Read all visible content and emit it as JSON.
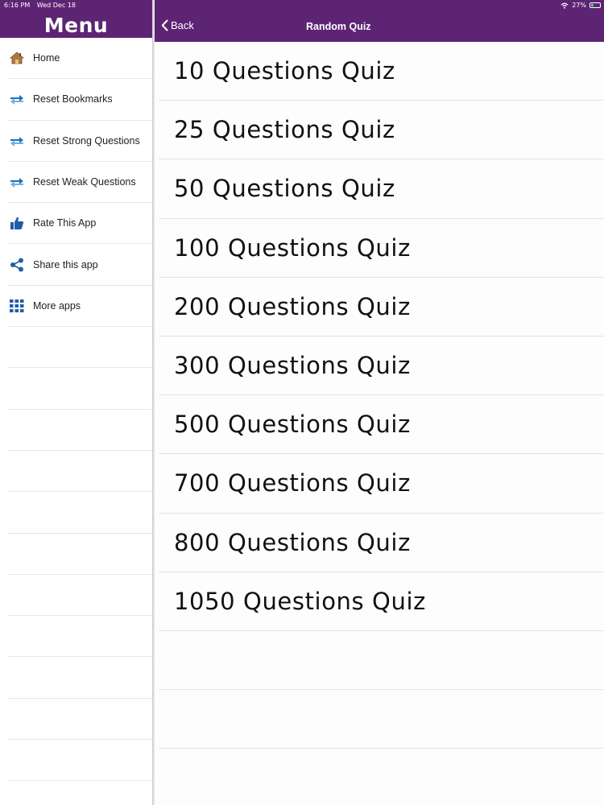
{
  "status_bar": {
    "time": "6:16 PM",
    "date": "Wed Dec 18",
    "battery": "27%"
  },
  "sidebar": {
    "title": "Menu",
    "items": [
      {
        "label": "Home",
        "icon": "house-icon"
      },
      {
        "label": "Reset Bookmarks",
        "icon": "reset-arrows-icon"
      },
      {
        "label": "Reset Strong Questions",
        "icon": "reset-arrows-icon"
      },
      {
        "label": "Reset Weak Questions",
        "icon": "reset-arrows-icon"
      },
      {
        "label": "Rate This App",
        "icon": "thumbs-up-icon"
      },
      {
        "label": "Share this app",
        "icon": "share-icon"
      },
      {
        "label": "More apps",
        "icon": "grid-icon"
      }
    ]
  },
  "navbar": {
    "back_label": "Back",
    "title": "Random Quiz"
  },
  "quizzes": [
    "10 Questions Quiz",
    "25 Questions Quiz",
    "50 Questions Quiz",
    "100 Questions Quiz",
    "200 Questions Quiz",
    "300 Questions Quiz",
    "500 Questions Quiz",
    "700 Questions Quiz",
    "800 Questions Quiz",
    "1050 Questions Quiz"
  ],
  "colors": {
    "header": "#5e2474",
    "icon_blue": "#1f5fa8",
    "battery_green": "#4cd964"
  }
}
